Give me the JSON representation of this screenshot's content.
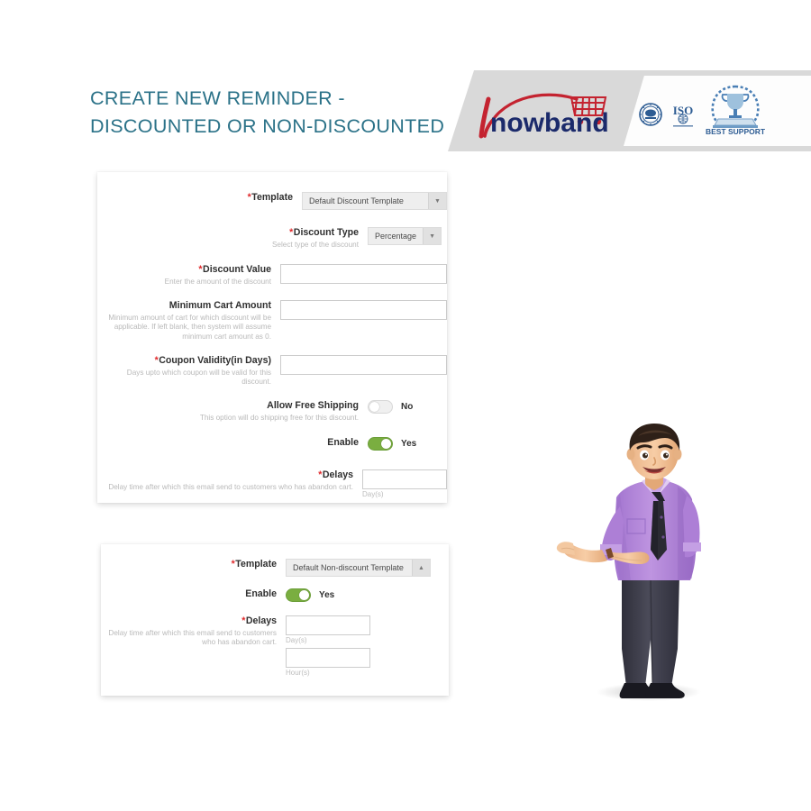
{
  "header": {
    "title": "CREATE NEW REMINDER - DISCOUNTED OR NON-DISCOUNTED",
    "title_color": "#2b7288",
    "brand_name": "knowband",
    "brand_band_color": "#d9d9d9",
    "badges": [
      {
        "name": "certification-seal-badge",
        "label": ""
      },
      {
        "name": "iso-badge",
        "label": "ISO"
      },
      {
        "name": "best-support-badge",
        "label": "BEST SUPPORT"
      }
    ]
  },
  "discount_panel": {
    "name": "discounted-reminder-form",
    "fields": [
      {
        "label": "Template",
        "required": true,
        "hint": "",
        "control": "select",
        "value": "Default Discount Template",
        "arrow": "chevron-down"
      },
      {
        "label": "Discount Type",
        "required": true,
        "hint": "Select type of the discount",
        "control": "select",
        "value": "Percentage",
        "arrow": "chevron-down"
      },
      {
        "label": "Discount Value",
        "required": true,
        "hint": "Enter the amount of the discount",
        "control": "text",
        "value": ""
      },
      {
        "label": "Minimum Cart Amount",
        "required": false,
        "hint": "Minimum amount of cart for which discount will be applicable. If left blank, then system will assume minimum cart amount as 0.",
        "control": "text",
        "value": ""
      },
      {
        "label": "Coupon Validity(in Days)",
        "required": true,
        "hint": "Days upto which coupon will be valid for this discount.",
        "control": "text",
        "value": ""
      },
      {
        "label": "Allow Free Shipping",
        "required": false,
        "hint": "This option will do shipping free for this discount.",
        "control": "toggle",
        "state": "off",
        "state_text": "No"
      },
      {
        "label": "Enable",
        "required": false,
        "hint": "",
        "control": "toggle",
        "state": "on",
        "state_text": "Yes"
      },
      {
        "label": "Delays",
        "required": true,
        "hint": "Delay time after which this email send to customers who has abandon cart.",
        "control": "text",
        "value": "",
        "unit": "Day(s)"
      }
    ]
  },
  "nondiscount_panel": {
    "name": "non-discounted-reminder-form",
    "fields": [
      {
        "label": "Template",
        "required": true,
        "hint": "",
        "control": "select",
        "value": "Default Non-discount Template",
        "arrow": "chevron-up"
      },
      {
        "label": "Enable",
        "required": false,
        "hint": "",
        "control": "toggle",
        "state": "on",
        "state_text": "Yes"
      },
      {
        "label": "Delays",
        "required": true,
        "hint": "Delay time after which this email send to customers who has abandon cart.",
        "control": "text-pair",
        "value_day": "",
        "unit_day": "Day(s)",
        "value_hour": "",
        "unit_hour": "Hour(s)"
      }
    ]
  },
  "mascot": {
    "name": "businessman-presenting-illustration",
    "shirt_color": "#b083d8",
    "pants_color": "#3b3b47",
    "tie_color": "#2b2b33",
    "skin_color": "#f2c49a",
    "hair_color": "#2e2018"
  },
  "theme": {
    "toggle_on_color": "#7aae40",
    "required_marker_color": "#e0292b",
    "hint_color": "#b9b9b9",
    "label_color": "#2f2f2f"
  }
}
